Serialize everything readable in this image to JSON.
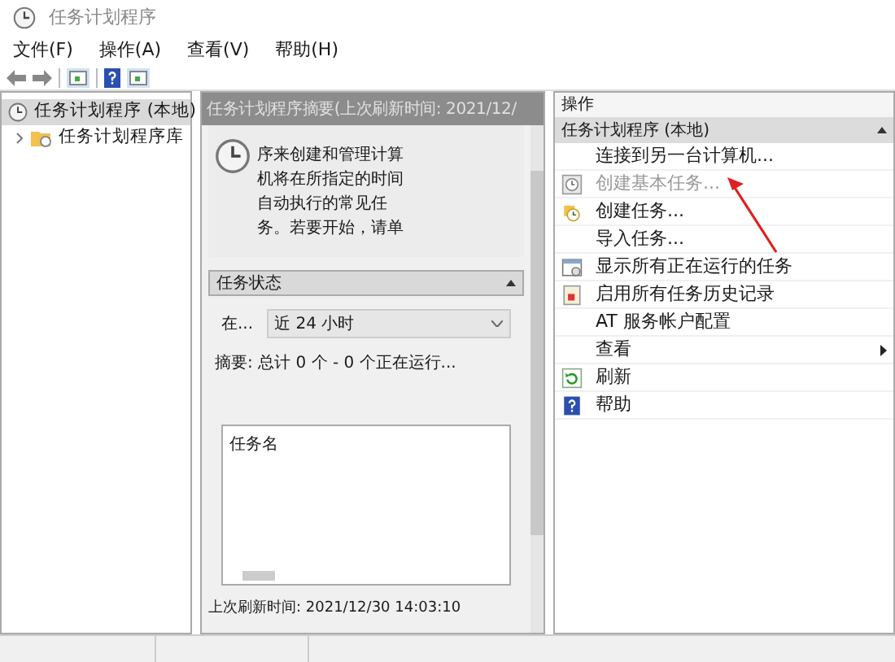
{
  "window": {
    "title": "任务计划程序"
  },
  "menu": [
    "文件(F)",
    "操作(A)",
    "查看(V)",
    "帮助(H)"
  ],
  "tree": [
    {
      "label": "任务计划程序 (本地)",
      "selected": true,
      "children": [
        {
          "label": "任务计划程序库",
          "selected": false,
          "expanded": false
        }
      ]
    }
  ],
  "summary": {
    "title": "任务计划程序摘要(上次刷新时间: 2021/12/",
    "description_lines": [
      "序来创建和管理计算",
      "机将在所指定的时间",
      "自动执行的常见任",
      "务。若要开始，请单"
    ],
    "status_section": {
      "title": "任务状态",
      "expanded": true,
      "filter_label": "在...",
      "filter_value": "近 24 小时",
      "summary": "摘要: 总计 0 个 - 0 个正在运行...",
      "list_column": "任务名"
    },
    "last_refresh": "上次刷新时间: 2021/12/30 14:03:10"
  },
  "actions": {
    "title": "操作",
    "group": {
      "title": "任务计划程序 (本地)",
      "expanded": true
    },
    "items": [
      {
        "label": "连接到另一台计算机...",
        "kind": "plain",
        "disabled": false
      },
      {
        "label": "创建基本任务...",
        "kind": "wizard",
        "disabled": true
      },
      {
        "label": "创建任务...",
        "kind": "task",
        "disabled": false
      },
      {
        "label": "导入任务...",
        "kind": "plain",
        "disabled": false
      },
      {
        "label": "显示所有正在运行的任务",
        "kind": "monitor",
        "disabled": false
      },
      {
        "label": "启用所有任务历史记录",
        "kind": "history",
        "disabled": false
      },
      {
        "label": "AT 服务帐户配置",
        "kind": "plain",
        "disabled": false
      },
      {
        "label": "查看",
        "kind": "submenu",
        "disabled": false
      },
      {
        "label": "刷新",
        "kind": "refresh",
        "disabled": false
      },
      {
        "label": "帮助",
        "kind": "help",
        "disabled": false
      }
    ]
  }
}
